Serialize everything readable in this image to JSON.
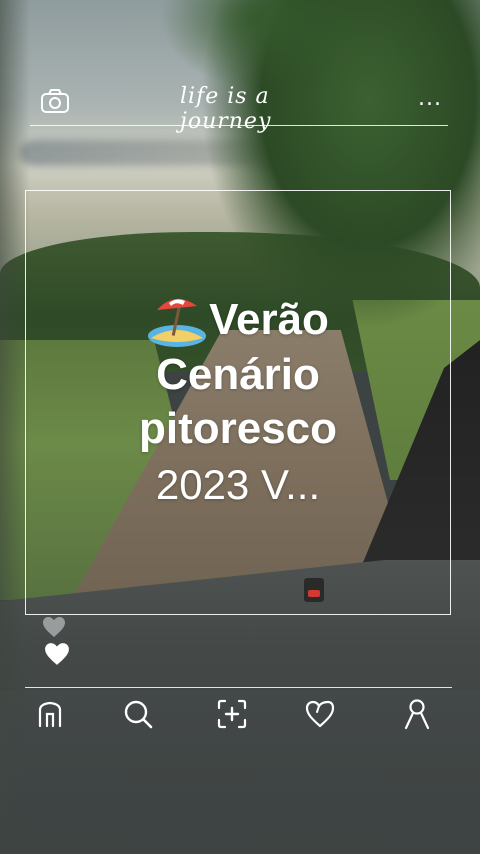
{
  "app": {
    "brand": "life is a journey"
  },
  "header": {
    "camera_icon": "camera-icon",
    "more_icon": "more-dots-icon",
    "more_label": "..."
  },
  "post": {
    "emoji_icon": "beach-umbrella-icon",
    "title_line1": "Verão",
    "title_line2": "Cenário",
    "title_line3": "pitoresco",
    "subtitle": "2023 V..."
  },
  "likes": {
    "heart_icon": "heart-icon"
  },
  "nav": {
    "items": [
      {
        "icon": "home-icon",
        "name": "Home"
      },
      {
        "icon": "search-icon",
        "name": "Search"
      },
      {
        "icon": "add-post-icon",
        "name": "Add"
      },
      {
        "icon": "heart-outline-icon",
        "name": "Likes"
      },
      {
        "icon": "profile-icon",
        "name": "Profile"
      }
    ]
  },
  "colors": {
    "overlay": "#ffffff",
    "accent_heart": "#ffffff"
  }
}
